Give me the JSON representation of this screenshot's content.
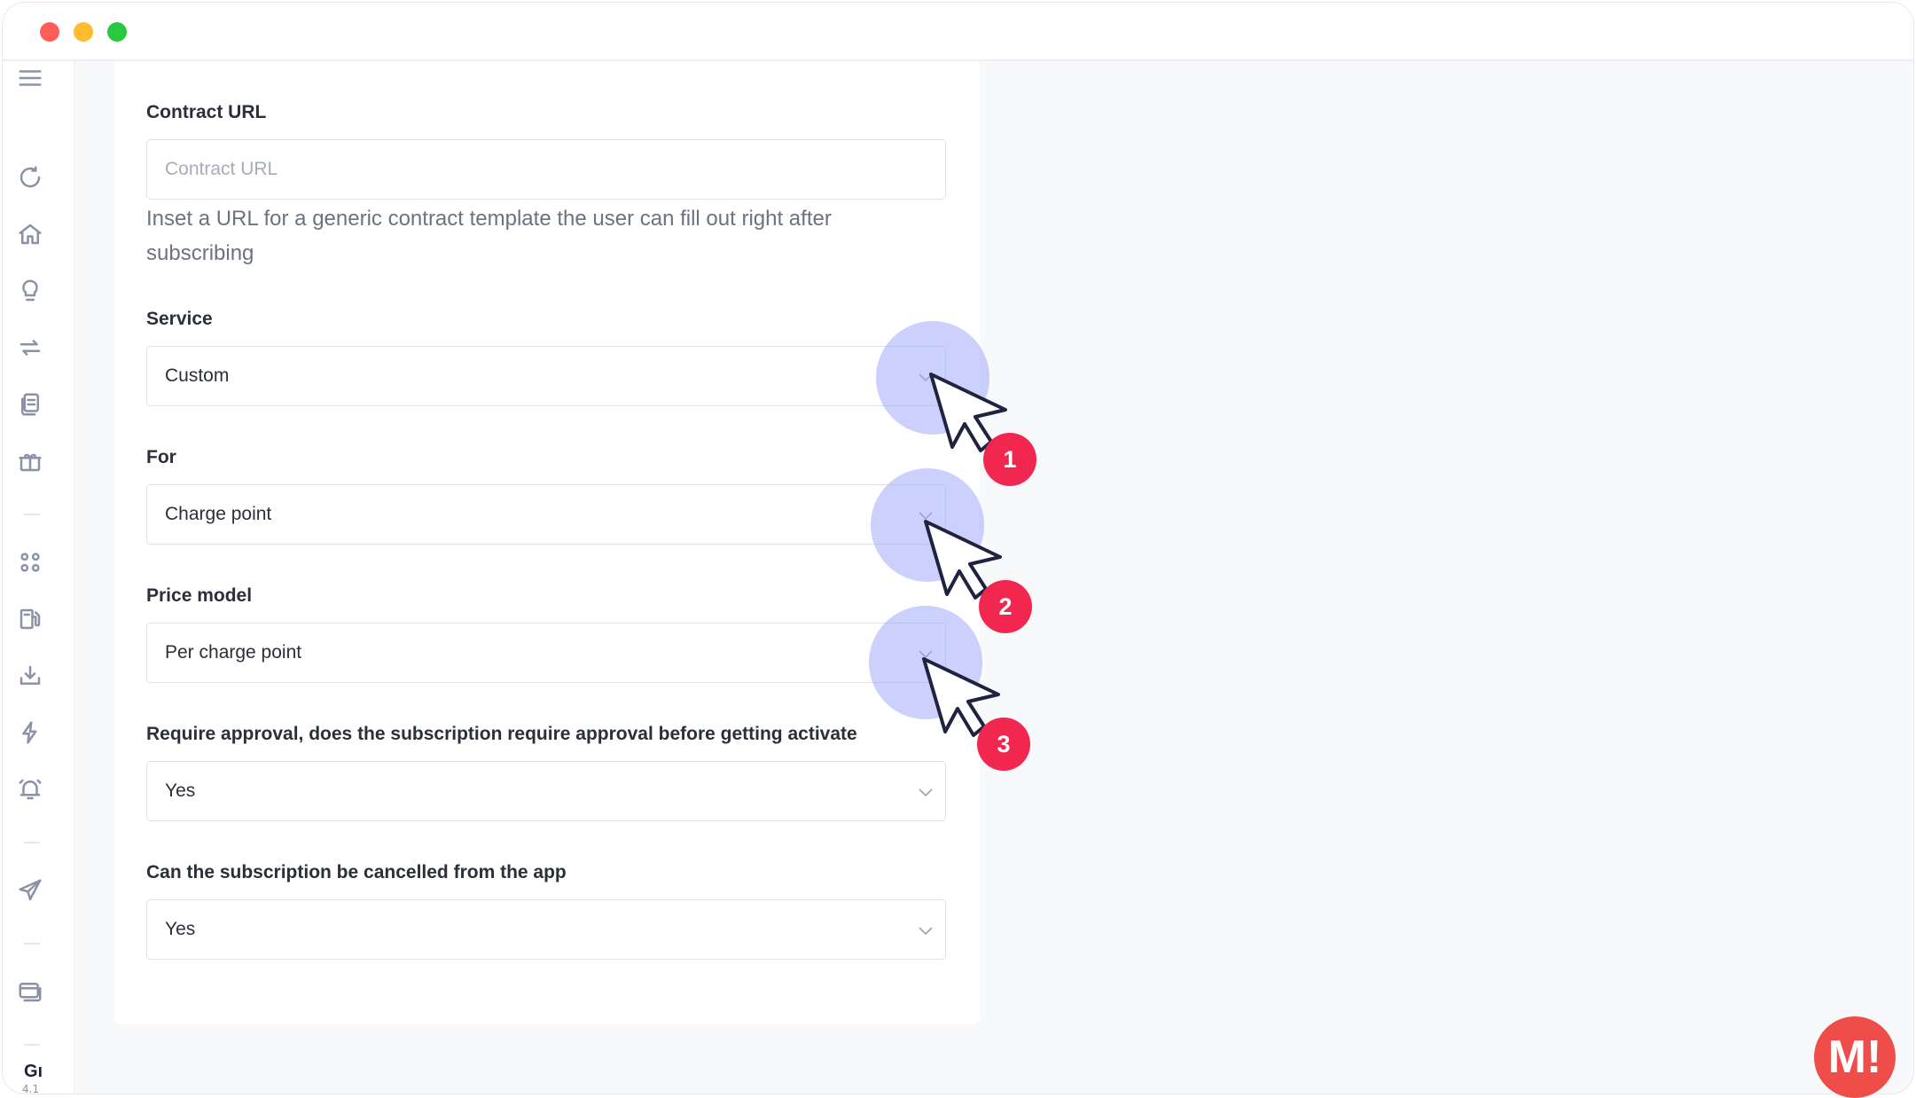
{
  "colors": {
    "accent_badge": "#f2274f",
    "halo": "#a0aafa",
    "brand": "#ef4d4a"
  },
  "window": {
    "controls": [
      "close",
      "minimize",
      "zoom"
    ]
  },
  "sidebar": {
    "icons": [
      "menu-icon",
      "refresh-icon",
      "home-icon",
      "lightbulb-icon",
      "transfer-icon",
      "documents-icon",
      "gift-icon",
      "apps-grid-icon",
      "fuel-station-icon",
      "download-icon",
      "lightning-icon",
      "alarm-icon",
      "send-icon",
      "cards-icon"
    ],
    "footer_text": "Gı",
    "footer_sub": "4.1"
  },
  "form": {
    "contract_url": {
      "label": "Contract URL",
      "placeholder": "Contract URL",
      "value": "",
      "help": "Inset a URL for a generic contract template the user can fill out right after subscribing"
    },
    "service": {
      "label": "Service",
      "value": "Custom"
    },
    "for": {
      "label": "For",
      "value": "Charge point"
    },
    "price_model": {
      "label": "Price model",
      "value": "Per charge point"
    },
    "require_approval": {
      "label": "Require approval, does the subscription require approval before getting activate",
      "value": "Yes"
    },
    "cancel_from_app": {
      "label": "Can the subscription be cancelled from the app",
      "value": "Yes"
    }
  },
  "annotations": {
    "steps": [
      "1",
      "2",
      "3"
    ]
  },
  "brand": {
    "logo_text": "M!"
  }
}
